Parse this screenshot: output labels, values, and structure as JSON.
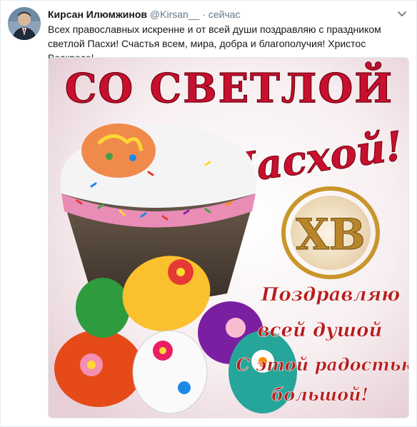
{
  "tweet": {
    "author_name": "Кирсан Илюмжинов",
    "author_handle": "@Kirsan__",
    "separator": "·",
    "time": "сейчас",
    "text": "Всех православных искренне и от всей души поздравляю с праздником светлой Пасхи! Счастья всем, мира, добра и благополучия! Христос Воскресе!"
  },
  "image": {
    "title_line1": "СО СВЕТЛОЙ",
    "title_line2": "Пасхой!",
    "monogram": "ХВ",
    "greeting_line1": "Поздравляю",
    "greeting_line2": "всей душой",
    "greeting_line3": "С этой радостью",
    "greeting_line4": "большой!"
  },
  "colors": {
    "name": "#14171a",
    "muted": "#657786",
    "title_red": "#c8102e",
    "gold": "#d4a52a"
  },
  "icons": {
    "chevron": "chevron-down-icon"
  }
}
